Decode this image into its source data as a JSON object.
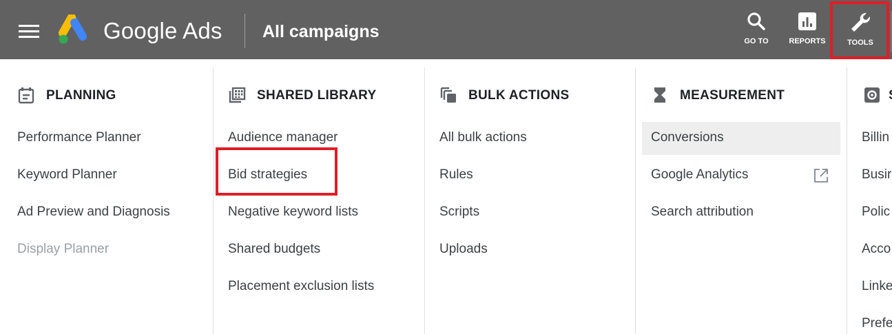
{
  "header": {
    "brand": "Google Ads",
    "page_title": "All campaigns",
    "buttons": {
      "goto": "GO TO",
      "reports": "REPORTS",
      "tools": "TOOLS"
    }
  },
  "columns": {
    "planning": {
      "title": "PLANNING",
      "icon": "calendar-note-icon",
      "items": [
        "Performance Planner",
        "Keyword Planner",
        "Ad Preview and Diagnosis",
        "Display Planner"
      ]
    },
    "shared_library": {
      "title": "SHARED LIBRARY",
      "icon": "library-grid-icon",
      "items": [
        "Audience manager",
        "Bid strategies",
        "Negative keyword lists",
        "Shared budgets",
        "Placement exclusion lists"
      ]
    },
    "bulk_actions": {
      "title": "BULK ACTIONS",
      "icon": "copy-stack-icon",
      "items": [
        "All bulk actions",
        "Rules",
        "Scripts",
        "Uploads"
      ]
    },
    "measurement": {
      "title": "MEASUREMENT",
      "icon": "hourglass-icon",
      "items": [
        "Conversions",
        "Google Analytics",
        "Search attribution"
      ]
    },
    "setup": {
      "title": "S",
      "icon": "gear-icon",
      "items": [
        "Billin",
        "Busir",
        "Polic",
        "Acco",
        "Linke",
        "Prefe"
      ]
    }
  },
  "colors": {
    "topbar": "#616161",
    "highlight": "#e01e25",
    "selected_row": "#eeeeee",
    "disabled_text": "#9aa0a6"
  }
}
